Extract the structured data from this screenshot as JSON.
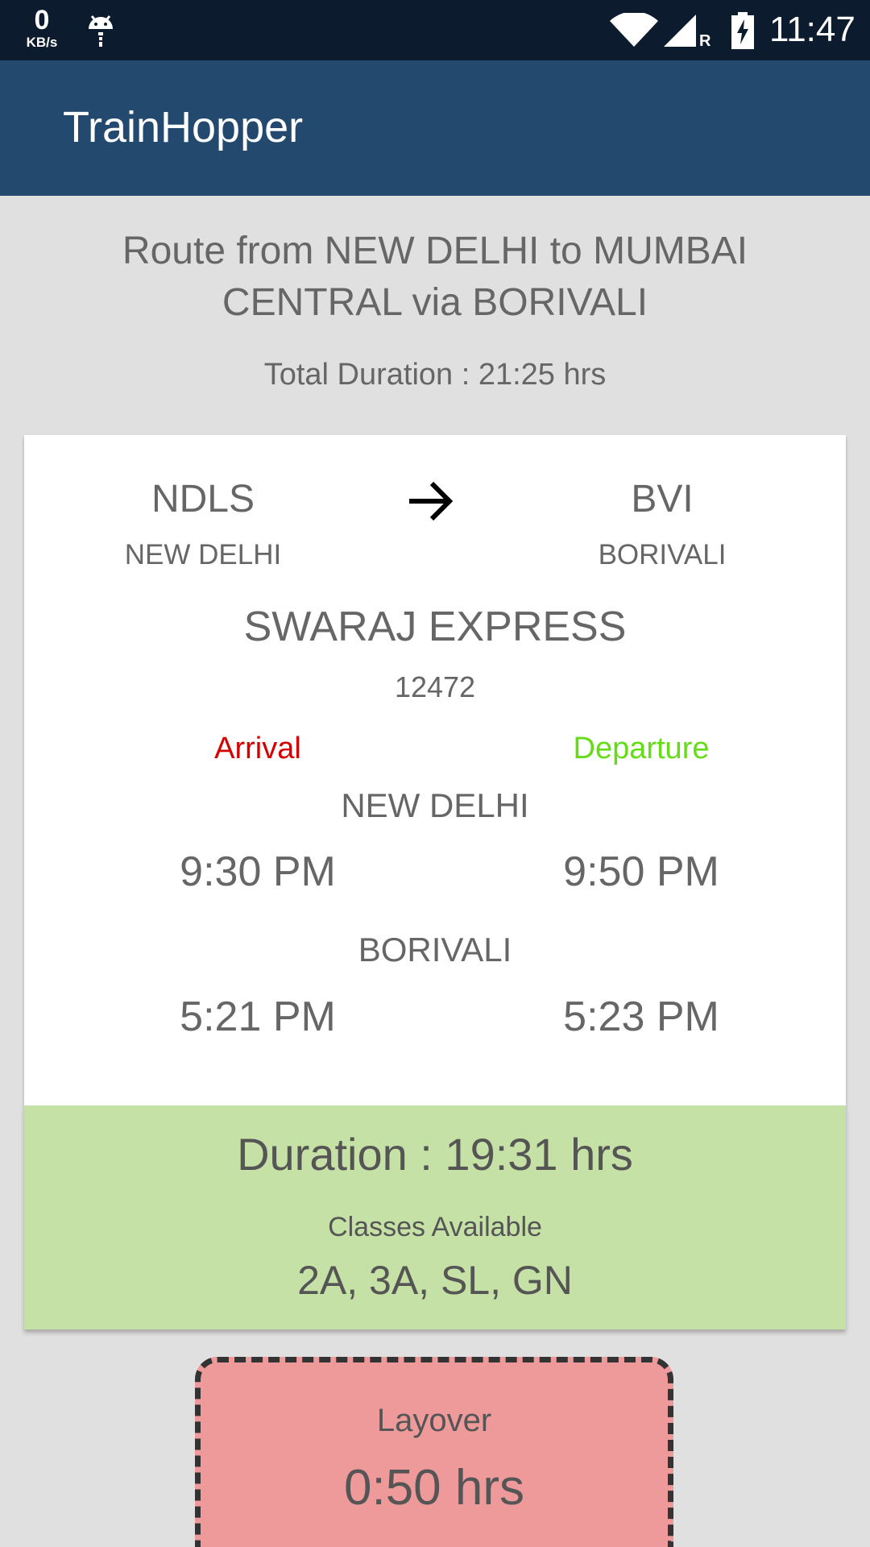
{
  "status_bar": {
    "speed_value": "0",
    "speed_unit": "KB/s",
    "roaming": "R",
    "time": "11:47"
  },
  "app_bar": {
    "title": "TrainHopper"
  },
  "route": {
    "title": "Route from NEW DELHI to MUMBAI CENTRAL via BORIVALI",
    "total_duration": "Total Duration : 21:25 hrs"
  },
  "leg": {
    "from_code": "NDLS",
    "from_name": "NEW DELHI",
    "to_code": "BVI",
    "to_name": "BORIVALI",
    "train_name": "SWARAJ EXPRESS",
    "train_number": "12472",
    "arrival_label": "Arrival",
    "departure_label": "Departure",
    "stops": [
      {
        "name": "NEW DELHI",
        "arrival": "9:30 PM",
        "departure": "9:50 PM"
      },
      {
        "name": "BORIVALI",
        "arrival": "5:21 PM",
        "departure": "5:23 PM"
      }
    ],
    "duration": "Duration : 19:31 hrs",
    "classes_label": "Classes Available",
    "classes": "2A, 3A, SL, GN"
  },
  "layover": {
    "label": "Layover",
    "value": "0:50 hrs"
  },
  "colors": {
    "app_bar": "#234a6e",
    "status_bar": "#0d1b2f",
    "arrival": "#d50000",
    "departure": "#64dd17",
    "duration_band": "#c5e1a5",
    "layover": "#ef9a9a"
  },
  "icons": [
    "android-icon",
    "wifi-icon",
    "signal-icon",
    "battery-charging-icon",
    "arrow-right-icon"
  ]
}
